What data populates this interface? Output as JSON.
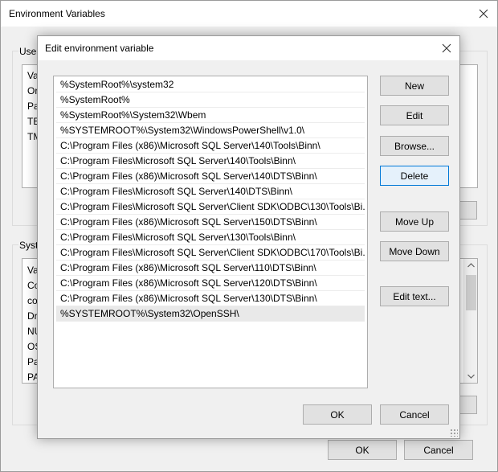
{
  "outer": {
    "title": "Environment Variables",
    "user_group_label": "User",
    "user_rows": [
      "Va",
      "Or",
      "Pa",
      "TE",
      "TM"
    ],
    "system_group_label": "Syste",
    "system_rows": [
      "Va",
      "Co",
      "co",
      "Dr",
      "NU",
      "OS",
      "Pa",
      "PA"
    ],
    "ok_label": "OK",
    "cancel_label": "Cancel"
  },
  "dialog": {
    "title": "Edit environment variable",
    "paths": [
      "%SystemRoot%\\system32",
      "%SystemRoot%",
      "%SystemRoot%\\System32\\Wbem",
      "%SYSTEMROOT%\\System32\\WindowsPowerShell\\v1.0\\",
      "C:\\Program Files (x86)\\Microsoft SQL Server\\140\\Tools\\Binn\\",
      "C:\\Program Files\\Microsoft SQL Server\\140\\Tools\\Binn\\",
      "C:\\Program Files (x86)\\Microsoft SQL Server\\140\\DTS\\Binn\\",
      "C:\\Program Files\\Microsoft SQL Server\\140\\DTS\\Binn\\",
      "C:\\Program Files\\Microsoft SQL Server\\Client SDK\\ODBC\\130\\Tools\\Bi...",
      "C:\\Program Files (x86)\\Microsoft SQL Server\\150\\DTS\\Binn\\",
      "C:\\Program Files\\Microsoft SQL Server\\130\\Tools\\Binn\\",
      "C:\\Program Files\\Microsoft SQL Server\\Client SDK\\ODBC\\170\\Tools\\Bi...",
      "C:\\Program Files (x86)\\Microsoft SQL Server\\110\\DTS\\Binn\\",
      "C:\\Program Files (x86)\\Microsoft SQL Server\\120\\DTS\\Binn\\",
      "C:\\Program Files (x86)\\Microsoft SQL Server\\130\\DTS\\Binn\\",
      "%SYSTEMROOT%\\System32\\OpenSSH\\"
    ],
    "selected_path": "%SYSTEMROOT%\\System32\\OpenSSH\\",
    "buttons": {
      "new": "New",
      "edit": "Edit",
      "browse": "Browse...",
      "delete": "Delete",
      "move_up": "Move Up",
      "move_down": "Move Down",
      "edit_text": "Edit text...",
      "ok": "OK",
      "cancel": "Cancel"
    },
    "focused_button": "delete"
  },
  "colors": {
    "window_bg": "#f0f0f0",
    "focus_border": "#0078d7",
    "focus_fill": "#e5f1fb",
    "selection": "#e9e9e9"
  },
  "icons": {
    "close": "close-icon",
    "scroll_up": "chevron-up-icon",
    "scroll_down": "chevron-down-icon",
    "resize": "resize-grip-icon"
  }
}
